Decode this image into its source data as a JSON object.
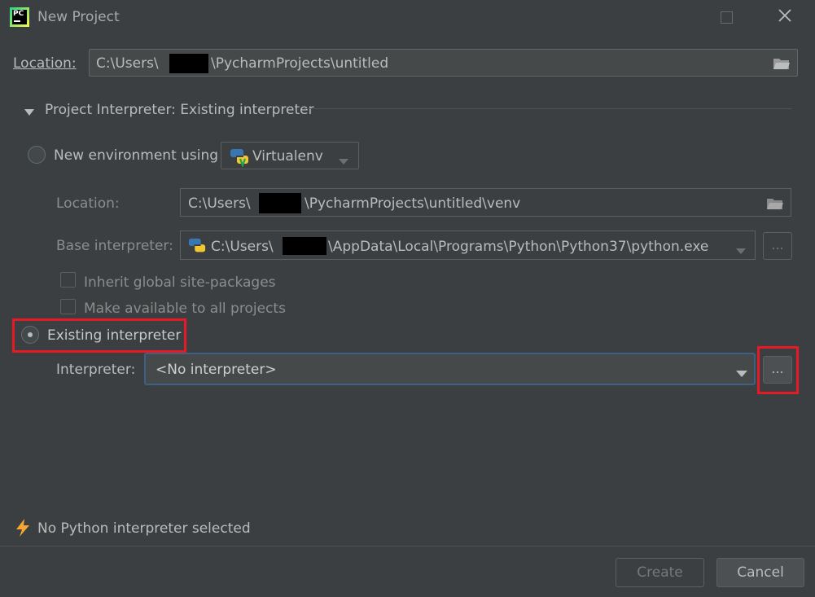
{
  "window": {
    "title": "New Project"
  },
  "location": {
    "label": "Location:",
    "value_prefix": "C:\\Users\\",
    "value_suffix": "\\PycharmProjects\\untitled"
  },
  "section": {
    "title": "Project Interpreter: Existing interpreter"
  },
  "new_env": {
    "label": "New environment using",
    "tool": "Virtualenv",
    "location_label": "Location:",
    "location_prefix": "C:\\Users\\",
    "location_suffix": "\\PycharmProjects\\untitled\\venv",
    "base_label": "Base interpreter:",
    "base_prefix": "C:\\Users\\",
    "base_suffix": "\\AppData\\Local\\Programs\\Python\\Python37\\python.exe",
    "inherit_label": "Inherit global site-packages",
    "make_available_label": "Make available to all projects"
  },
  "existing": {
    "label": "Existing interpreter",
    "interpreter_label": "Interpreter:",
    "interpreter_value": "<No interpreter>"
  },
  "browse_label": "...",
  "warning": {
    "text": "No Python interpreter selected"
  },
  "buttons": {
    "create": "Create",
    "cancel": "Cancel"
  },
  "colors": {
    "background": "#3c3f41",
    "highlight": "#e51a25",
    "focus": "#3d6185"
  }
}
